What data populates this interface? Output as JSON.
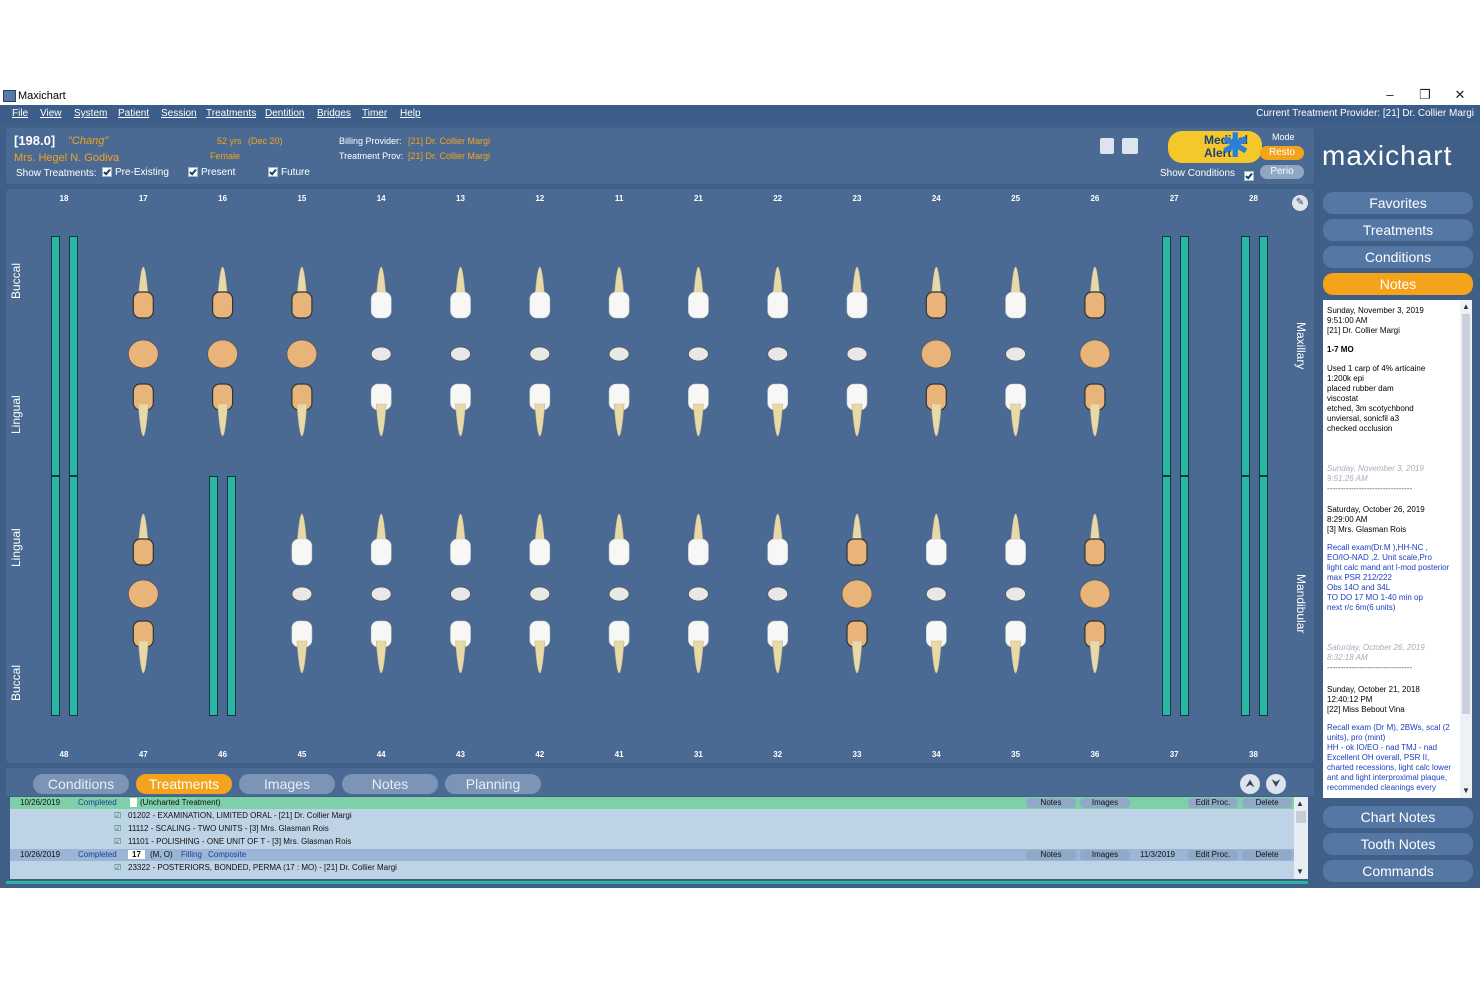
{
  "window": {
    "title": "Maxichart",
    "minimize": "–",
    "restore": "❐",
    "close": "✕"
  },
  "menu": {
    "items": [
      "File",
      "View",
      "System",
      "Patient",
      "Session",
      "Treatments",
      "Dentition",
      "Bridges",
      "Timer",
      "Help"
    ],
    "provider": "Current Treatment Provider: [21] Dr. Collier Margi"
  },
  "patient": {
    "id": "[198.0]",
    "nickname": "\"Chang\"",
    "name": "Mrs. Hegel N. Godiva",
    "age": "52 yrs",
    "dob": "(Dec 20)",
    "sex": "Female",
    "billing_label": "Billing Provider:",
    "billing_value": "[21] Dr. Collier Margi",
    "treatment_label": "Treatment Prov:",
    "treatment_value": "[21] Dr. Collier Margi",
    "show_treatments": "Show Treatments:",
    "pre_existing": "Pre-Existing",
    "present": "Present",
    "future": "Future",
    "medical_alert_1": "Medical",
    "medical_alert_2": "Alert",
    "mode_label": "Mode",
    "mode_resto": "Resto",
    "mode_perio": "Perio",
    "show_conditions": "Show Conditions"
  },
  "colors": {
    "accent": "#f4a31a",
    "teal": "#2ab6a4",
    "panel": "#4a6a94",
    "bg": "#3f5f87"
  },
  "chart": {
    "upper_numbers": [
      "18",
      "17",
      "16",
      "15",
      "14",
      "13",
      "12",
      "11",
      "21",
      "22",
      "23",
      "24",
      "25",
      "26",
      "27",
      "28"
    ],
    "lower_numbers": [
      "48",
      "47",
      "46",
      "45",
      "44",
      "43",
      "42",
      "41",
      "31",
      "32",
      "33",
      "34",
      "35",
      "36",
      "37",
      "38"
    ],
    "labels": {
      "buccal_top": "Buccal",
      "lingual_top": "Lingual",
      "lingual_bottom": "Lingual",
      "buccal_bottom": "Buccal",
      "maxillary": "Maxillary",
      "mandibular": "Mandibular"
    }
  },
  "tabs": [
    "Conditions",
    "Treatments",
    "Images",
    "Notes",
    "Planning"
  ],
  "treatment_list": {
    "r1": {
      "date": "10/26/2019",
      "status": "Completed",
      "desc": "(Uncharted Treatment)",
      "notes": "Notes",
      "images": "Images",
      "edit": "Edit Proc.",
      "delete": "Delete"
    },
    "r2": {
      "desc": "01202 - EXAMINATION, LIMITED ORAL - [21] Dr. Collier Margi"
    },
    "r3": {
      "desc": "11112 - SCALING - TWO UNITS - [3] Mrs. Glasman Rois"
    },
    "r4": {
      "desc": "11101 - POLISHING - ONE UNIT OF T - [3] Mrs. Glasman Rois"
    },
    "r5": {
      "date": "10/26/2019",
      "status": "Completed",
      "tooth": "17",
      "surf": "(M, O)",
      "kind": "Filling",
      "material": "Composite",
      "notes": "Notes",
      "images": "Images",
      "pdate": "11/3/2019",
      "edit": "Edit Proc.",
      "delete": "Delete"
    },
    "r6": {
      "desc": "23322 - POSTERIORS, BONDED, PERMA (17 : MO) - [21] Dr. Collier Margi"
    }
  },
  "sidebar": {
    "logo": "maxichart",
    "favorites": "Favorites",
    "treatments": "Treatments",
    "conditions": "Conditions",
    "notes": "Notes",
    "chart_notes": "Chart Notes",
    "tooth_notes": "Tooth Notes",
    "commands": "Commands"
  },
  "notes": {
    "n1_date": "Sunday, November 3, 2019",
    "n1_time": "9:51:00 AM",
    "n1_prov": "[21] Dr. Collier Margi",
    "n1_title": "1-7 MO",
    "n1_body": [
      "Used 1 carp of 4% articaine",
      "1:200k epi",
      "placed rubber dam",
      "viscostat",
      "etched, 3m scotychbond",
      "unviersal, sonicfil a3",
      "checked occlusion"
    ],
    "n1_sig1": "Sunday, November 3, 2019",
    "n1_sig2": "9:51:26 AM",
    "n2_date": "Saturday, October 26, 2019",
    "n2_time": "8:29:00 AM",
    "n2_prov": "[3] Mrs. Glasman Rois",
    "n2_body": [
      "Recall exam(Dr.M ),HH-NC ,",
      "EO/IO-NAD ,2. Unit scale,Pro",
      "light calc mand ant l-mod posterior",
      "max PSR 212/222",
      "Obs 14O and 34L",
      "TO DO 17 MO 1-40 min op",
      "next r/c 6m(6 units)"
    ],
    "n2_sig1": "Saturday, October 26, 2019",
    "n2_sig2": "8:32:18 AM",
    "n3_date": "Sunday, October 21, 2018",
    "n3_time": "12:40:12 PM",
    "n3_prov": "[22] Miss Bebout Vina",
    "n3_body": [
      "Recall exam (Dr M), 2BWs, scal (2",
      "units), pro (mint)",
      "HH - ok  IO/EO - nad  TMJ - nad",
      "Excellent OH overall, PSR II,",
      "charted recessions, light calc lower",
      "ant and light interproximal plaque,",
      "recommended cleanings every"
    ],
    "divider": "--------------------------------"
  }
}
